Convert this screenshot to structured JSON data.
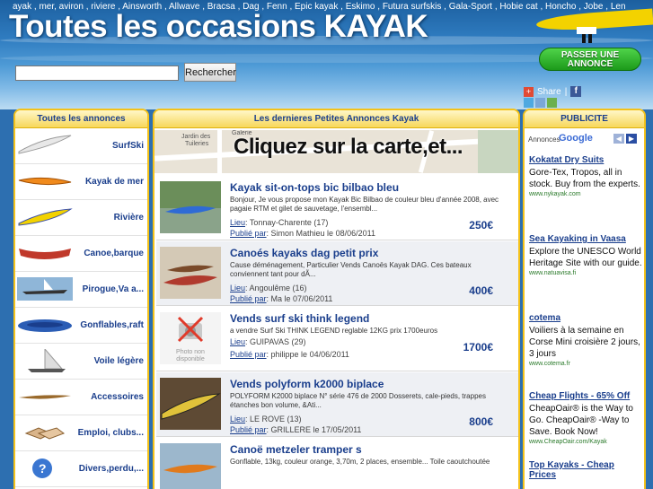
{
  "header": {
    "keywords": "ayak , mer, aviron , riviere , Ainsworth , Allwave , Bracsa , Dag , Fenn , Epic kayak , Eskimo , Futura surfskis , Gala-Sport , Hobie cat , Honcho , Jobe , Len",
    "title": "Toutes les occasions KAYAK",
    "search_value": "",
    "search_button": "Rechercher",
    "post_button_line1": "PASSER UNE",
    "post_button_line2": "ANNONCE",
    "share_label": "Share",
    "share_sep": "|"
  },
  "left": {
    "heading": "Toutes les annonces",
    "categories": [
      {
        "label": "SurfSki"
      },
      {
        "label": "Kayak de mer"
      },
      {
        "label": "Rivière"
      },
      {
        "label": "Canoe,barque"
      },
      {
        "label": "Pirogue,Va a..."
      },
      {
        "label": "Gonflables,raft"
      },
      {
        "label": "Voile légère"
      },
      {
        "label": "Accessoires"
      },
      {
        "label": "Emploi, clubs..."
      },
      {
        "label": "Divers,perdu,..."
      }
    ]
  },
  "mid": {
    "heading": "Les dernieres Petites Annonces Kayak",
    "map_cta": "Cliquez sur la carte,et...",
    "map_labels": [
      "Jardin des",
      "Tuileries",
      "Galerie"
    ],
    "lieu_label": "Lieu",
    "pub_label": "Publié par",
    "listings": [
      {
        "title": "Kayak sit-on-tops bic bilbao bleu",
        "desc": "Bonjour, Je vous propose mon Kayak Bic Bilbao de couleur bleu d'année 2008, avec pagaie RTM et gilet de sauvetage, l'ensembl...",
        "lieu": ": Tonnay-Charente (17)",
        "pub": ": Simon Mathieu le 08/06/2011",
        "price": "250€"
      },
      {
        "title": "Canoés kayaks dag petit prix",
        "desc": "Cause déménagement, Particulier Vends Canoës Kayak DAG. Ces bateaux conviennent tant pour dÃ...",
        "lieu": ": Angoulême (16)",
        "pub": ": Ma le 07/06/2011",
        "price": "400€"
      },
      {
        "title": "Vends surf ski think legend",
        "desc": "a vendre Surf Ski THINK LEGEND reglable 12KG prix 1700euros",
        "lieu": ": GUIPAVAS (29)",
        "pub": ": philippe le 04/06/2011",
        "price": "1700€"
      },
      {
        "title": "Vends polyform k2000 biplace",
        "desc": "POLYFORM K2000 biplace N° série 476 de 2000 Dosserets, cale-pieds, trappes étanches bon volume, &Ati...",
        "lieu": ": LE ROVE (13)",
        "pub": ": GRILLERE le 17/05/2011",
        "price": "800€"
      },
      {
        "title": "Canoë metzeler tramper s",
        "desc": "Gonflable, 13kg, couleur orange, 3,70m, 2 places, ensemble... Toile caoutchoutée",
        "lieu": "",
        "pub": "",
        "price": ""
      }
    ],
    "no_photo_line1": "Photo non",
    "no_photo_line2": "disponible"
  },
  "right": {
    "heading": "PUBLICITE",
    "ads_by": "Annonces",
    "google": "Google",
    "ads": [
      {
        "title": "Kokatat Dry Suits",
        "text": "Gore-Tex, Tropos, all in stock. Buy from the experts.",
        "url": "www.nykayak.com"
      },
      {
        "title": "Sea Kayaking in Vaasa",
        "text": "Explore the UNESCO World Heritage Site with our guide.",
        "url": "www.natuavisa.fi"
      },
      {
        "title": "cotema",
        "text": "Voiliers à la semaine en Corse Mini croisière 2 jours, 3 jours",
        "url": "www.cotema.fr"
      },
      {
        "title": "Cheap Flights - 65% Off",
        "text": "CheapOair® is the Way to Go. CheapOair® -Way to Save. Book Now!",
        "url": "www.CheapOair.com/Kayak"
      },
      {
        "title": "Top Kayaks - Cheap Prices",
        "text": "",
        "url": ""
      }
    ]
  },
  "colors": {
    "accent": "#f4c21b",
    "link": "#1a3e8c",
    "post_button": "#2fbf2c"
  }
}
